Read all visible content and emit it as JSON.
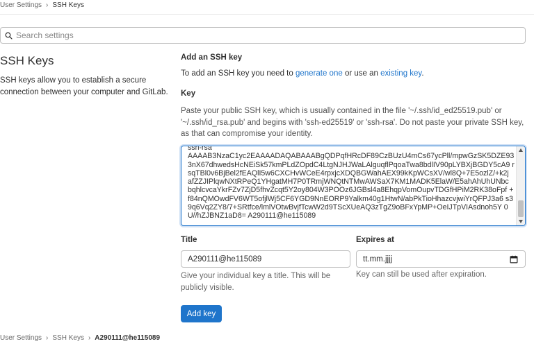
{
  "breadcrumb_top": {
    "items": [
      "User Settings",
      "SSH Keys"
    ]
  },
  "search": {
    "placeholder": "Search settings"
  },
  "sidebar": {
    "title": "SSH Keys",
    "description": "SSH keys allow you to establish a secure connection between your computer and GitLab."
  },
  "form": {
    "heading": "Add an SSH key",
    "intro_prefix": "To add an SSH key you need to ",
    "generate_link": "generate one",
    "intro_middle": " or use an ",
    "existing_link": "existing key",
    "intro_suffix": ".",
    "key_label": "Key",
    "key_help": "Paste your public SSH key, which is usually contained in the file '~/.ssh/id_ed25519.pub' or '~/.ssh/id_rsa.pub' and begins with 'ssh-ed25519' or 'ssh-rsa'. Do not paste your private SSH key, as that can compromise your identity.",
    "key_value": "ssh-rsa\nAAAAB3NzaC1yc2EAAAADAQABAAABgQDPqfHRcDF89CzBUzU4mCs67ycPll/mpwGzSK5DZE93 3nX67dhwedsHcNEiSk57kmPLdZOpdC4LtgNJHJWaLAlguqflPqoaTwa8bdlIV90pLYBXjBGDY5cA9 rsqTBl0v6BjBel2fEAQlI5w6CXCHvWCeE4rpxjcXDQBGWahAEX99kKpWCsXV/wl8Q+7E5ozlZ/+k2j afZZJIPlqwNXtRPeQ1YHgatMH7P0TRmjWNQtNTMwAWSaX7KM1MADK5ElaW/E5ahAhUhUNbc bqhlcvcaYkrFZv7ZjD5fhvZcqt5Y2oy804W3POOz6JGBsl4a8EhqpVomOupvTDGfHPiM2RK38oFpf +f84nQMOwdFV6WT5ofjlWj5CF6YGD9NnEORP9Yalkm40g1HtwN/abPkTioHhazcvjwiYrQFPJ3a6 s39q6Vq2ZY8/7+SRtfce/lmlVOtwBvjfTcwW2d9TScXUeAQ3zTgZ9oBFxYpMP+OeIJTpVIAsdnoh5Y 0U//hZJBNZ1aD8= A290111@he115089",
    "title_label": "Title",
    "title_value": "A290111@he115089",
    "title_help": "Give your individual key a title. This will be publicly visible.",
    "expires_label": "Expires at",
    "expires_value": "tt.mm.jjjj",
    "expires_help": "Key can still be used after expiration.",
    "submit_label": "Add key"
  },
  "breadcrumb_bottom": {
    "items": [
      "User Settings",
      "SSH Keys",
      "A290111@he115089"
    ]
  },
  "colors": {
    "accent": "#1f75cb",
    "border": "#bfbfbf"
  },
  "icons": {
    "search": "search-icon",
    "calendar": "calendar-icon",
    "chevron": "chevron-right-icon"
  }
}
